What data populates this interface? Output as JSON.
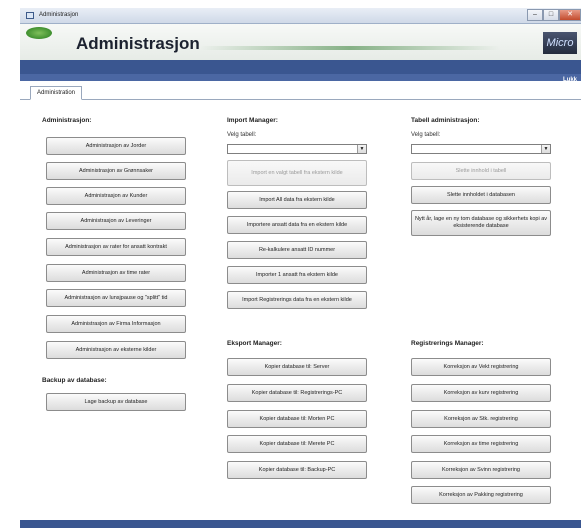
{
  "window": {
    "title": "Administrasjon",
    "controls": {
      "minimize": "–",
      "maximize": "□",
      "close": "✕"
    }
  },
  "header": {
    "app_title": "Administrasjon",
    "brand": "Micro"
  },
  "toolbar": {
    "close_label": "Lukk"
  },
  "tabs": [
    {
      "label": "Administration"
    }
  ],
  "admin": {
    "title": "Administrasjon:",
    "buttons": [
      "Administrasjon av Jorder",
      "Administrasjon av Grønnsaker",
      "Administrasjon av Kunder",
      "Administrasjon av Leveringer",
      "Administrasjon av rater for ansatt kontrakt",
      "Administrasjon av time rater",
      "Administrasjon av lunsjpause og \"splitt\" tid",
      "Administrasjon av Firma Informasjon",
      "Administrasjon av eksterne kilder"
    ]
  },
  "backup": {
    "title": "Backup av database:",
    "button": "Lage backup av database"
  },
  "import": {
    "title": "Import Manager:",
    "select_label": "Velg tabell:",
    "select_value": "",
    "buttons": [
      "Import en valgt tabell fra ekstern kilde",
      "Import All data fra ekstern kilde",
      "Importere ansatt data fra en ekstern kilde",
      "Re-kalkulere ansatt ID nummer",
      "Importer 1 ansatt fra ekstern kilde",
      "Import Registrerings data fra en ekstern kilde"
    ]
  },
  "table_admin": {
    "title": "Tabell administrasjon:",
    "select_label": "Velg tabell:",
    "select_value": "",
    "buttons": [
      "Slette innhold i tabell",
      "Slette innholdet i databasen",
      "Nytt år, lage en ny tom database og sikkerhets kopi av eksisterende database"
    ]
  },
  "export": {
    "title": "Eksport Manager:",
    "buttons": [
      "Kopier database til: Server",
      "Kopier database til: Registrerings-PC",
      "Kopier database til: Morten PC",
      "Kopier database til: Merete PC",
      "Kopier database til: Backup-PC"
    ]
  },
  "registration": {
    "title": "Registrerings Manager:",
    "buttons": [
      "Korreksjon av Vekt registrering",
      "Korreksjon av kurv registrering",
      "Korreksjon av Stk. registrering",
      "Korreksjon av time registrering",
      "Korreksjon av Svinn registrering",
      "Korreksjon av Pakking registrering"
    ]
  }
}
